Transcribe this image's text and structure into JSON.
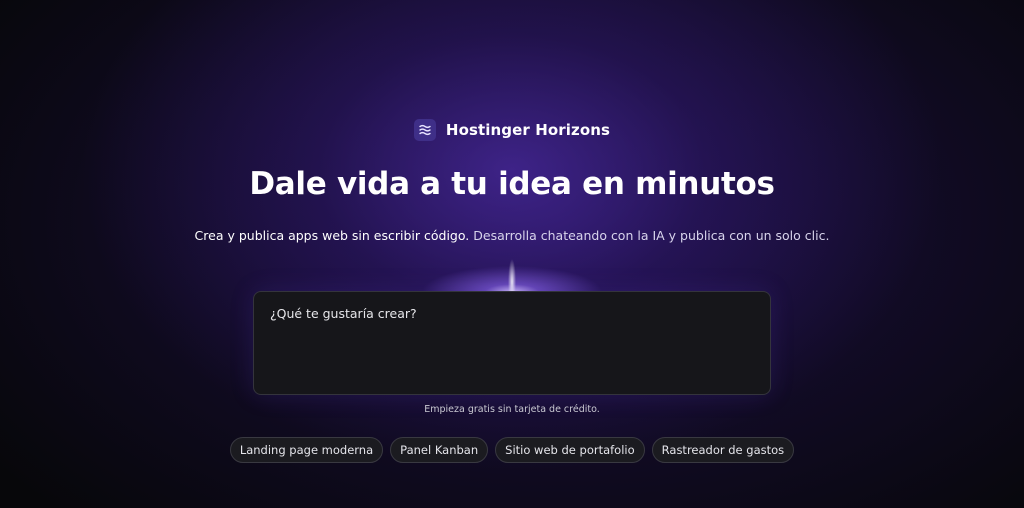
{
  "brand": {
    "name": "Hostinger Horizons",
    "logo_icon": "waves-icon"
  },
  "hero": {
    "headline": "Dale vida a tu idea en minutos",
    "subtitle_a": "Crea y publica apps web sin escribir código.",
    "subtitle_b": " Desarrolla chateando con la IA y publica con un solo clic."
  },
  "prompt": {
    "placeholder": "¿Qué te gustaría crear?",
    "value": ""
  },
  "note": "Empieza gratis sin tarjeta de crédito.",
  "suggestions": [
    {
      "label": "Landing page moderna"
    },
    {
      "label": "Panel Kanban"
    },
    {
      "label": "Sitio web de portafolio"
    },
    {
      "label": "Rastreador de gastos"
    }
  ],
  "colors": {
    "background": "#07070a",
    "glow": "#5c34c8",
    "logo_bg": "#3f2f88",
    "input_bg": "#16161a",
    "chip_bg": "#1b1b20"
  }
}
